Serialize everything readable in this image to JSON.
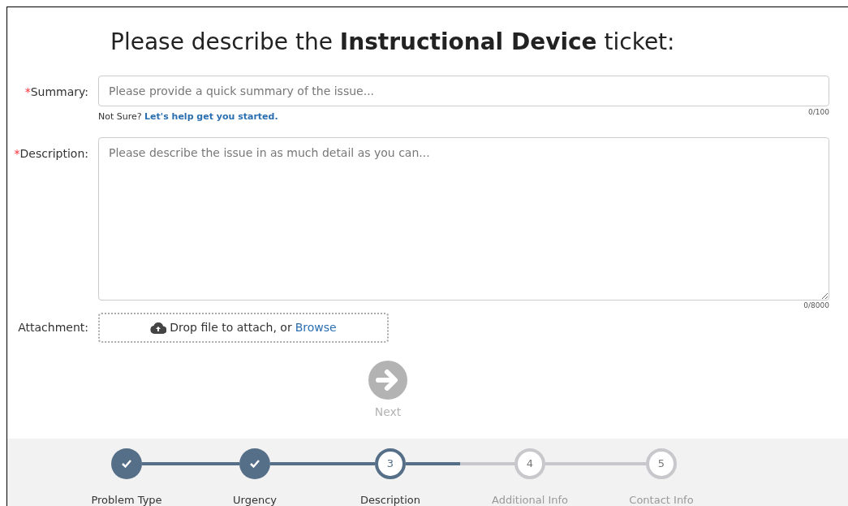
{
  "title": "Please describe the **Instructional Device** ticket:",
  "summary": {
    "required_mark": "*",
    "label": "Summary:",
    "placeholder": "Please provide a quick summary of the issue...",
    "hint": "Not Sure?",
    "help_link": "Let's help get you started.",
    "counter": "0/100"
  },
  "description": {
    "required_mark": "*",
    "label": "Description:",
    "placeholder": "Please describe the issue in as much detail as you can...",
    "counter": "0/8000"
  },
  "attachment": {
    "label": "Attachment:",
    "drop_text": "Drop file to attach, or",
    "browse_link": "Browse"
  },
  "next_button": {
    "label": "Next",
    "disabled": true
  },
  "stepper": {
    "steps": [
      {
        "label": "Problem Type",
        "completed": true,
        "selected": false
      },
      {
        "label": "Urgency",
        "completed": true,
        "selected": false
      },
      {
        "label": "Description",
        "completed": false,
        "selected": true,
        "number": "3"
      },
      {
        "label": "Additional Info",
        "completed": false,
        "selected": false,
        "number": "4"
      },
      {
        "label": "Contact Info",
        "completed": false,
        "selected": false,
        "number": "5"
      }
    ],
    "connectors": [
      {
        "level": 1
      },
      {
        "level": 1
      },
      {
        "level": 0.5
      },
      {
        "level": 0
      }
    ]
  }
}
